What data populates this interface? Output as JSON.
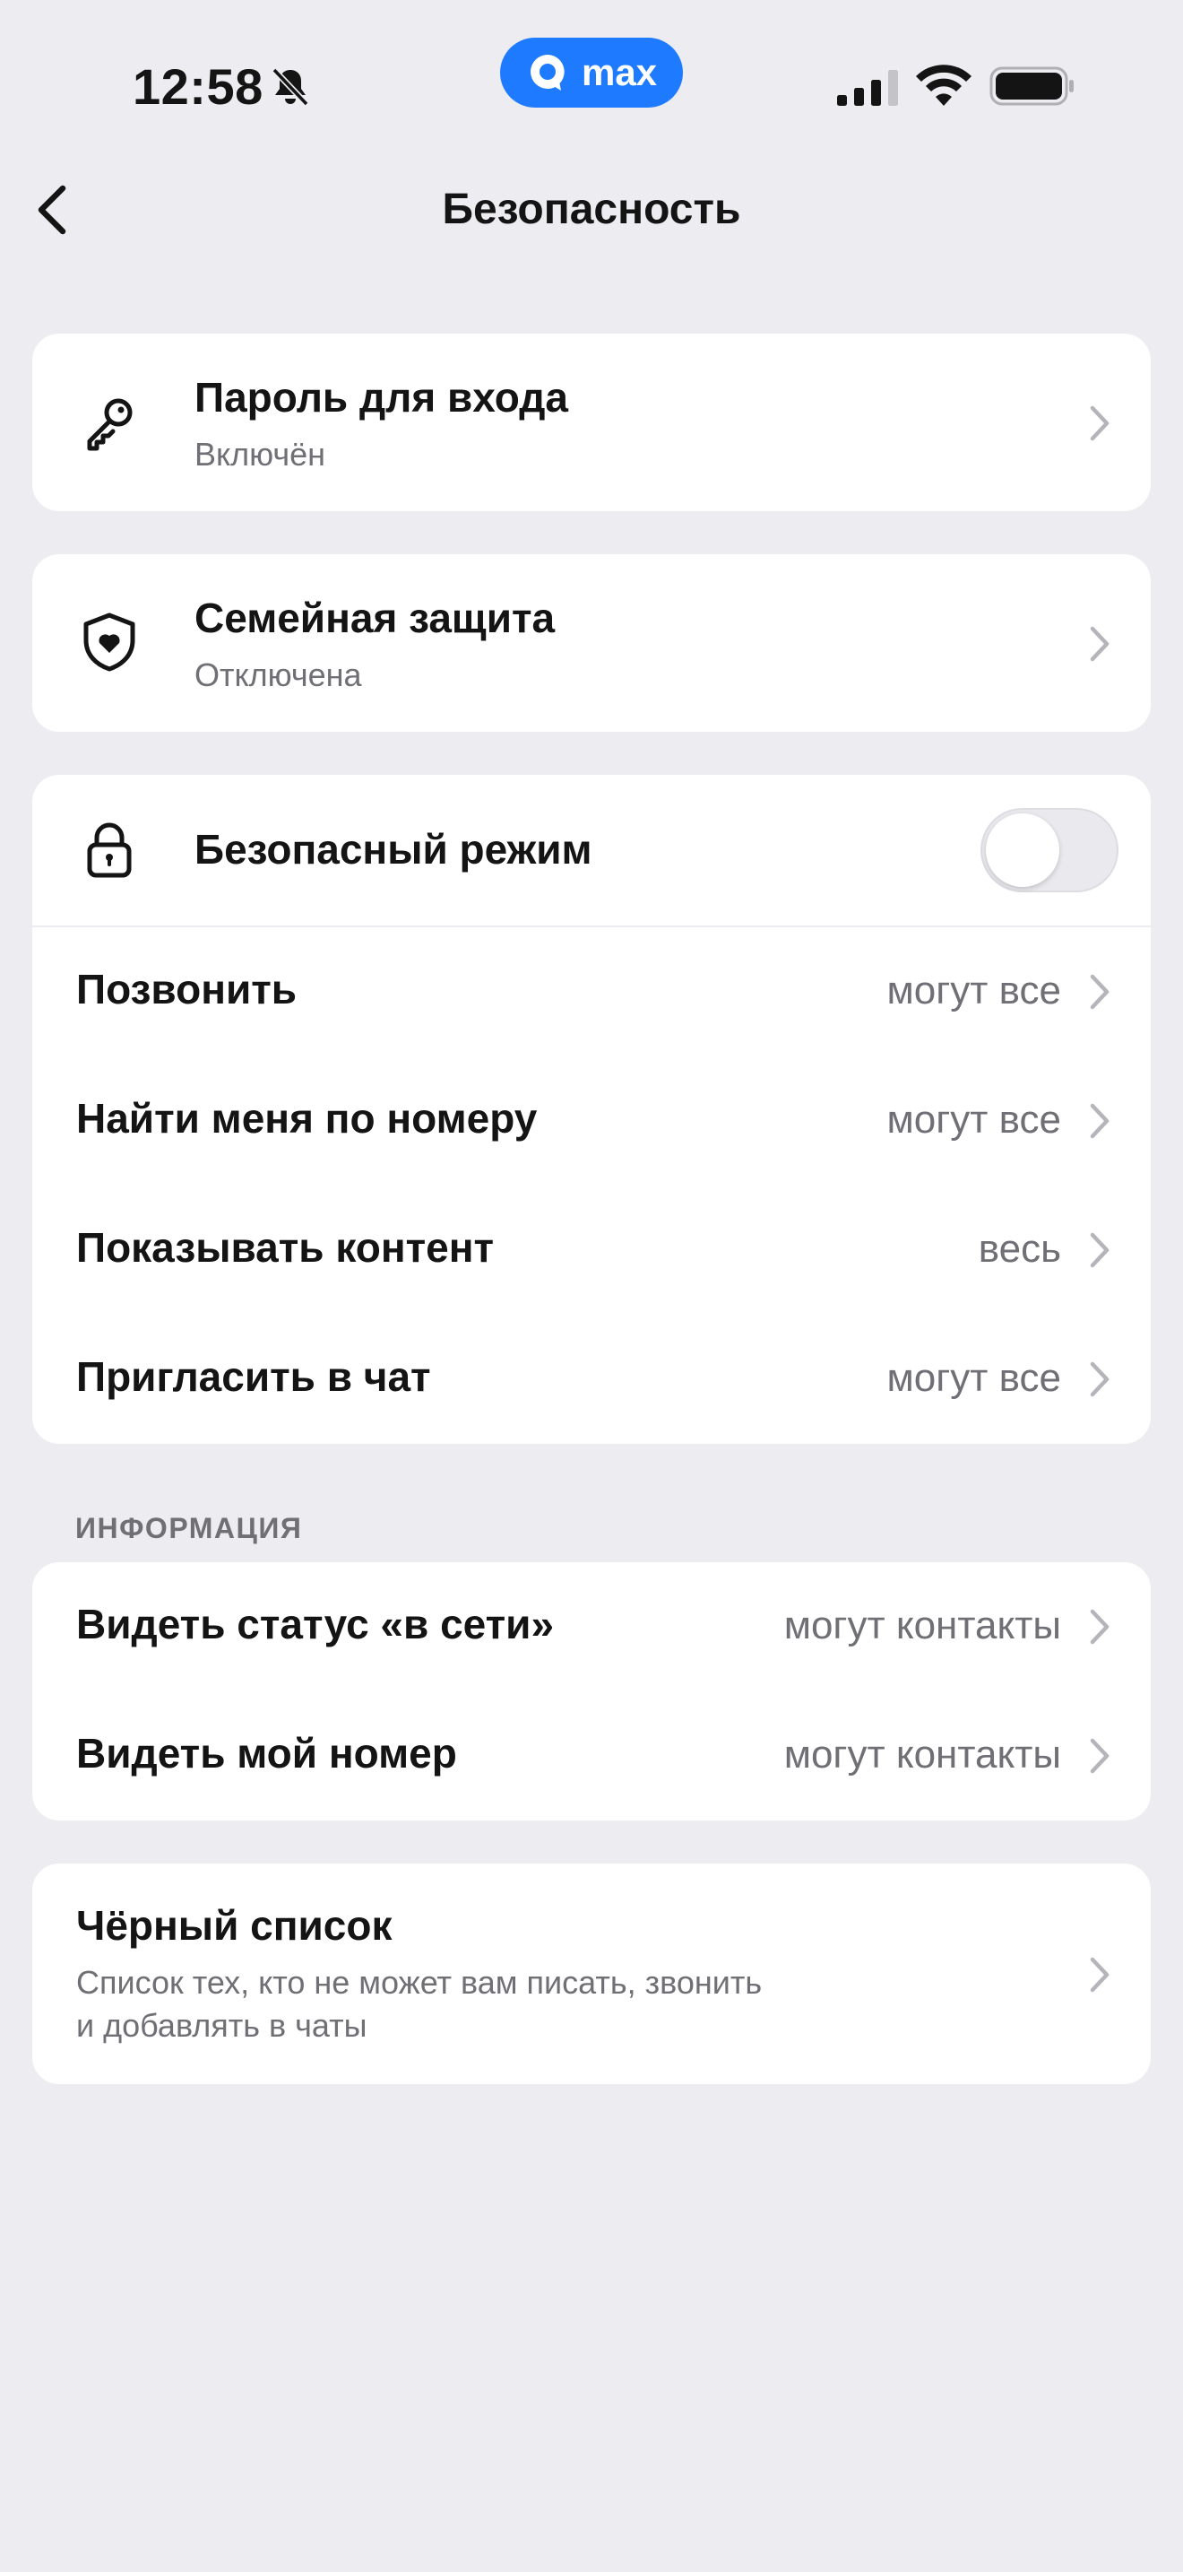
{
  "status_bar": {
    "time": "12:58",
    "app_badge": "max",
    "icons": [
      "bell-off-icon",
      "signal-icon",
      "wifi-icon",
      "battery-icon"
    ]
  },
  "header": {
    "title": "Безопасность",
    "back_icon": "chevron-left-icon"
  },
  "password": {
    "title": "Пароль для входа",
    "status": "Включён",
    "icon": "key-icon"
  },
  "family": {
    "title": "Семейная защита",
    "status": "Отключена",
    "icon": "shield-heart-icon"
  },
  "safe_mode": {
    "title": "Безопасный режим",
    "icon": "lock-icon",
    "enabled": false
  },
  "privacy_rows": [
    {
      "label": "Позвонить",
      "value": "могут все"
    },
    {
      "label": "Найти меня по номеру",
      "value": "могут все"
    },
    {
      "label": "Показывать контент",
      "value": "весь"
    },
    {
      "label": "Пригласить в чат",
      "value": "могут все"
    }
  ],
  "info_section": {
    "label": "ИНФОРМАЦИЯ",
    "rows": [
      {
        "label": "Видеть статус «в сети»",
        "value": "могут контакты"
      },
      {
        "label": "Видеть мой номер",
        "value": "могут контакты"
      }
    ]
  },
  "blacklist": {
    "title": "Чёрный список",
    "description_line1": "Список тех, кто не может вам писать, звонить",
    "description_line2": "и добавлять в чаты"
  },
  "colors": {
    "background": "#ececf1",
    "accent": "#1e7bff",
    "secondary_text": "#6f6f75",
    "chevron": "#b4b4ba"
  }
}
